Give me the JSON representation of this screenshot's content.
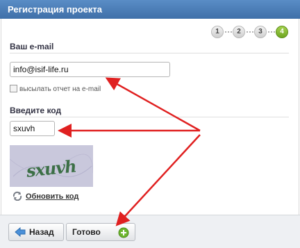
{
  "header": {
    "title": "Регистрация проекта"
  },
  "steps": [
    "1",
    "2",
    "3",
    "4"
  ],
  "active_step": "4",
  "email_section": {
    "title": "Ваш e-mail",
    "value": "info@isif-life.ru",
    "checkbox_label": "высылать отчет на e-mail"
  },
  "code_section": {
    "title": "Введите код",
    "value": "sxuvh",
    "captcha_text": "sxuvh",
    "refresh_label": "Обновить код"
  },
  "footer": {
    "back_label": "Назад",
    "done_label": "Готово"
  },
  "colors": {
    "header": "#4a7db8",
    "active_step": "#7cb62a",
    "arrow": "#e02020"
  }
}
